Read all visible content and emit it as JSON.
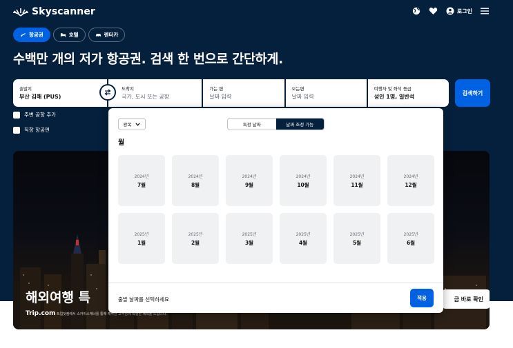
{
  "header": {
    "logo_text": "Skyscanner",
    "login_label": "로그인"
  },
  "tabs": [
    {
      "label": "항공권",
      "active": true,
      "icon": "plane-icon"
    },
    {
      "label": "호텔",
      "active": false,
      "icon": "bed-icon"
    },
    {
      "label": "렌터카",
      "active": false,
      "icon": "car-icon"
    }
  ],
  "headline": "수백만 개의 저가 항공권. 검색 한 번으로 간단하게.",
  "search": {
    "from": {
      "label": "출발지",
      "value": "부산 김해 (PUS)"
    },
    "to": {
      "label": "도착지",
      "placeholder": "국가, 도시 또는 공항"
    },
    "depart": {
      "label": "가는 편",
      "placeholder": "날짜 입력"
    },
    "return": {
      "label": "오는편",
      "placeholder": "날짜 입력"
    },
    "travelers": {
      "label": "여행자 및 좌석 등급",
      "value": "성인 1명, 일반석"
    },
    "search_button": "검색하기",
    "nearby_airports": "주변 공항 추가",
    "direct_flights": "직항 항공편"
  },
  "banner": {
    "title": "해외여행 특",
    "brand": "Trip.com",
    "subtitle": "트립닷컴에서 스카이스캐너를 통해 예약한 고객님께 특별한 혜택을 드립니다.",
    "button": "금 바로 확인"
  },
  "calendar": {
    "trip_type": "왕복",
    "segments": [
      "특정 날짜",
      "날짜 조정 가능"
    ],
    "active_segment": 1,
    "section_title": "월",
    "months": [
      {
        "year": "2024년",
        "month": "7월"
      },
      {
        "year": "2024년",
        "month": "8월"
      },
      {
        "year": "2024년",
        "month": "9월"
      },
      {
        "year": "2024년",
        "month": "10월"
      },
      {
        "year": "2024년",
        "month": "11월"
      },
      {
        "year": "2024년",
        "month": "12월"
      },
      {
        "year": "2025년",
        "month": "1월"
      },
      {
        "year": "2025년",
        "month": "2월"
      },
      {
        "year": "2025년",
        "month": "3월"
      },
      {
        "year": "2025년",
        "month": "4월"
      },
      {
        "year": "2025년",
        "month": "5월"
      },
      {
        "year": "2025년",
        "month": "6월"
      }
    ],
    "footer_text": "출발 날짜를 선택하세요",
    "apply_button": "적용"
  },
  "colors": {
    "brand_dark": "#05203c",
    "accent_blue": "#0062e3",
    "cell_bg": "#eff1f2"
  }
}
